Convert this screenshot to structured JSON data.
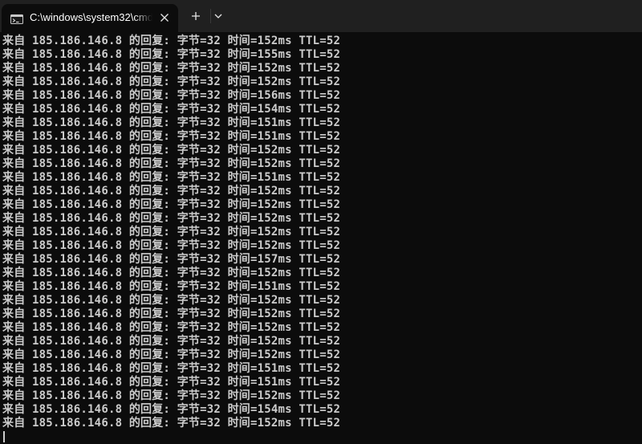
{
  "window": {
    "tab_title": "C:\\windows\\system32\\cmd.exe",
    "icons": {
      "tab": "terminal-icon",
      "close": "close-icon",
      "new_tab": "plus-icon",
      "dropdown": "chevron-down-icon"
    },
    "colors": {
      "titlebar": "#202020",
      "background": "#0c0c0c",
      "text": "#cccccc"
    }
  },
  "console": {
    "lines": [
      "来自 185.186.146.8 的回复: 字节=32 时间=152ms TTL=52",
      "来自 185.186.146.8 的回复: 字节=32 时间=155ms TTL=52",
      "来自 185.186.146.8 的回复: 字节=32 时间=152ms TTL=52",
      "来自 185.186.146.8 的回复: 字节=32 时间=152ms TTL=52",
      "来自 185.186.146.8 的回复: 字节=32 时间=156ms TTL=52",
      "来自 185.186.146.8 的回复: 字节=32 时间=154ms TTL=52",
      "来自 185.186.146.8 的回复: 字节=32 时间=151ms TTL=52",
      "来自 185.186.146.8 的回复: 字节=32 时间=151ms TTL=52",
      "来自 185.186.146.8 的回复: 字节=32 时间=152ms TTL=52",
      "来自 185.186.146.8 的回复: 字节=32 时间=152ms TTL=52",
      "来自 185.186.146.8 的回复: 字节=32 时间=151ms TTL=52",
      "来自 185.186.146.8 的回复: 字节=32 时间=152ms TTL=52",
      "来自 185.186.146.8 的回复: 字节=32 时间=152ms TTL=52",
      "来自 185.186.146.8 的回复: 字节=32 时间=152ms TTL=52",
      "来自 185.186.146.8 的回复: 字节=32 时间=152ms TTL=52",
      "来自 185.186.146.8 的回复: 字节=32 时间=152ms TTL=52",
      "来自 185.186.146.8 的回复: 字节=32 时间=157ms TTL=52",
      "来自 185.186.146.8 的回复: 字节=32 时间=152ms TTL=52",
      "来自 185.186.146.8 的回复: 字节=32 时间=151ms TTL=52",
      "来自 185.186.146.8 的回复: 字节=32 时间=152ms TTL=52",
      "来自 185.186.146.8 的回复: 字节=32 时间=152ms TTL=52",
      "来自 185.186.146.8 的回复: 字节=32 时间=152ms TTL=52",
      "来自 185.186.146.8 的回复: 字节=32 时间=152ms TTL=52",
      "来自 185.186.146.8 的回复: 字节=32 时间=152ms TTL=52",
      "来自 185.186.146.8 的回复: 字节=32 时间=151ms TTL=52",
      "来自 185.186.146.8 的回复: 字节=32 时间=151ms TTL=52",
      "来自 185.186.146.8 的回复: 字节=32 时间=152ms TTL=52",
      "来自 185.186.146.8 的回复: 字节=32 时间=154ms TTL=52",
      "来自 185.186.146.8 的回复: 字节=32 时间=152ms TTL=52"
    ]
  }
}
